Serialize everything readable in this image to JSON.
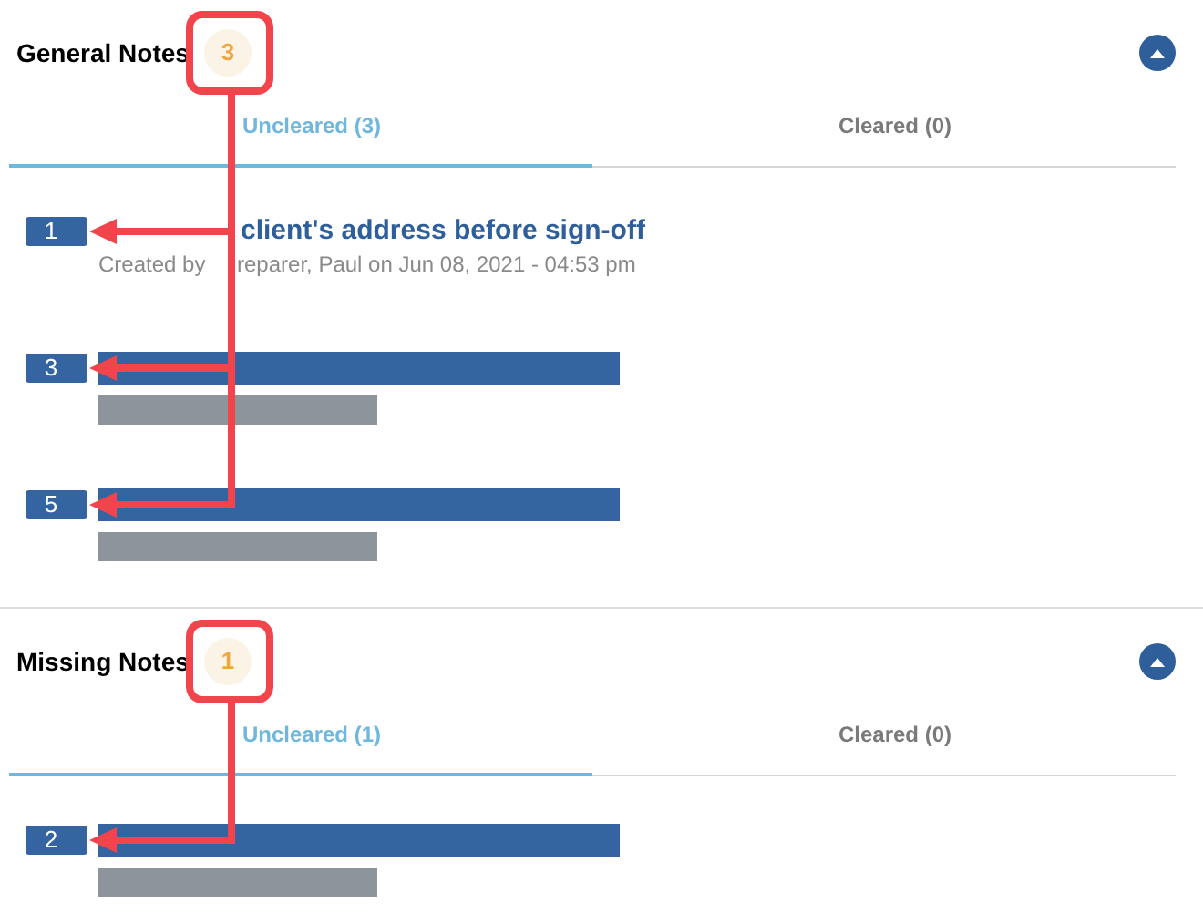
{
  "sections": [
    {
      "title": "General Notes",
      "count": "3",
      "expanded": true,
      "tabs": [
        {
          "label": "Uncleared (3)",
          "selected": true
        },
        {
          "label": "Cleared (0)",
          "selected": false
        }
      ],
      "notes": [
        {
          "kind": "note",
          "marker": "1",
          "title": "client's address before sign-off",
          "meta_start": "Created by",
          "meta_end": "reparer, Paul on Jun 08, 2021 - 04:53 pm"
        },
        {
          "kind": "redacted",
          "marker": "3"
        },
        {
          "kind": "redacted",
          "marker": "5"
        }
      ]
    },
    {
      "title": "Missing Notes",
      "count": "1",
      "expanded": true,
      "tabs": [
        {
          "label": "Uncleared (1)",
          "selected": true
        },
        {
          "label": "Cleared (0)",
          "selected": false
        }
      ],
      "notes": [
        {
          "kind": "redacted",
          "marker": "2"
        }
      ]
    }
  ]
}
